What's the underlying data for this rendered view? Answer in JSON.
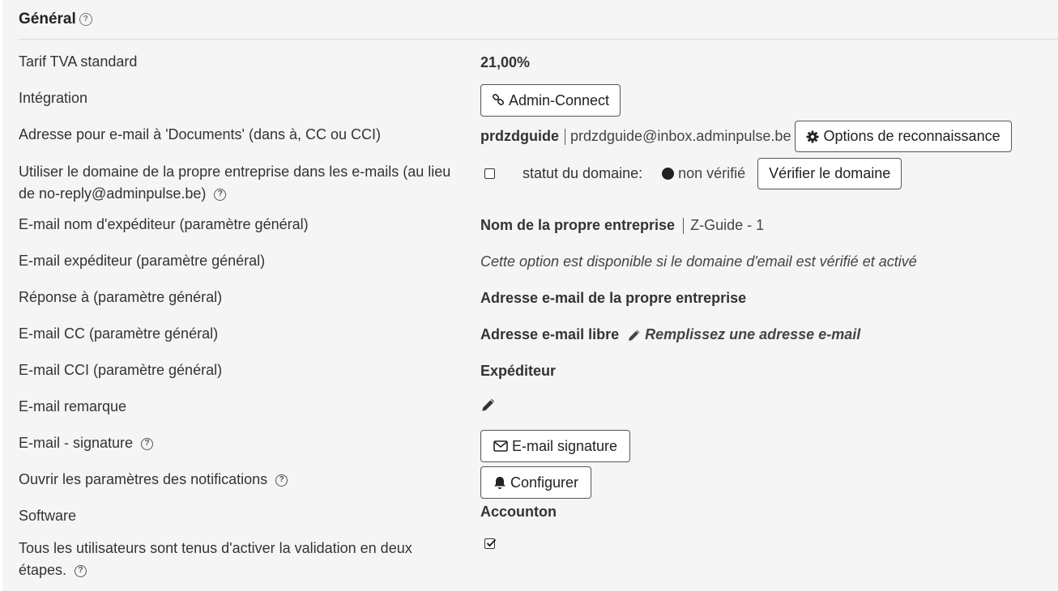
{
  "section": {
    "title": "Général"
  },
  "rows": {
    "vat": {
      "label": "Tarif TVA standard",
      "value": "21,00%"
    },
    "integration": {
      "label": "Intégration",
      "button": "Admin-Connect"
    },
    "documents_email": {
      "label": "Adresse pour e-mail à 'Documents' (dans à, CC ou CCI)",
      "name": "prdzdguide",
      "address": "prdzdguide@inbox.adminpulse.be",
      "button": "Options de reconnaissance"
    },
    "own_domain": {
      "label": "Utiliser le domaine de la propre entreprise dans les e-mails (au lieu de no-reply@adminpulse.be)",
      "checked": false,
      "status_label": "statut du domaine:",
      "status_value": "non vérifié",
      "button": "Vérifier le domaine"
    },
    "sender_name": {
      "label": "E-mail nom d'expéditeur (paramètre général)",
      "value": "Nom de la propre entreprise",
      "detail": "Z-Guide - 1"
    },
    "sender_email": {
      "label": "E-mail expéditeur (paramètre général)",
      "value": "Cette option est disponible si le domaine d'email est vérifié et activé"
    },
    "reply_to": {
      "label": "Réponse à (paramètre général)",
      "value": "Adresse e-mail de la propre entreprise"
    },
    "cc": {
      "label": "E-mail CC (paramètre général)",
      "value": "Adresse e-mail libre",
      "edit_text": "Remplissez une adresse e-mail"
    },
    "bcc": {
      "label": "E-mail CCI (paramètre général)",
      "value": "Expéditeur"
    },
    "remark": {
      "label": "E-mail remarque"
    },
    "signature": {
      "label": "E-mail - signature",
      "button": "E-mail signature"
    },
    "notifications": {
      "label": "Ouvrir les paramètres des notifications",
      "button": "Configurer"
    },
    "software": {
      "label": "Software",
      "value": "Accounton"
    },
    "two_factor": {
      "label": "Tous les utilisateurs sont tenus d'activer la validation en deux étapes.",
      "checked": true
    }
  },
  "icons": {
    "help": "question-circle-icon",
    "link": "link-icon",
    "gear": "cog-icon",
    "pencil": "pencil-icon",
    "envelope": "envelope-icon",
    "bell": "bell-icon",
    "status_dot": "circle-icon"
  }
}
